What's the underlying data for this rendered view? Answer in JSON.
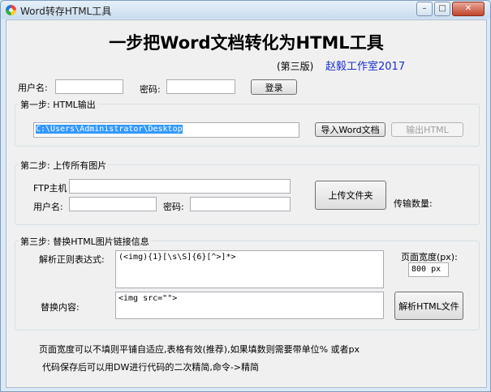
{
  "window": {
    "title": "Word转存HTML工具",
    "minimize_glyph": "–",
    "maximize_glyph": "□",
    "close_glyph": "✕"
  },
  "header": {
    "heading": "一步把Word文档转化为HTML工具",
    "edition": "(第三版)",
    "studio": "赵毅工作室2017",
    "studio_color": "#1a2fd0"
  },
  "login": {
    "username_label": "用户名:",
    "password_label": "密码:",
    "username_value": "",
    "password_value": "",
    "login_button": "登录"
  },
  "step1": {
    "title": "第一步: HTML输出",
    "path_value": "C:\\Users\\Administrator\\Desktop",
    "import_button": "导入Word文档",
    "export_button": "输出HTML",
    "selection_color": "#3399ff"
  },
  "step2": {
    "title": "第二步: 上传所有图片",
    "ftp_host_label": "FTP主机",
    "username_label": "用户名:",
    "password_label": "密码:",
    "ftp_host_value": "",
    "username_value": "",
    "password_value": "",
    "upload_button": "上传文件夹",
    "transfer_count_label": "传输数量:"
  },
  "step3": {
    "title": "第三步: 替换HTML图片链接信息",
    "regex_label": "解析正则表达式:",
    "regex_value": "(<img){1}[\\s\\S]{6}[^>]*>",
    "page_width_label": "页面宽度(px):",
    "page_width_value": "800 px",
    "replace_label": "替换内容:",
    "replace_value": "<img src=\"\">",
    "parse_button": "解析HTML文件"
  },
  "notes": {
    "line1": "页面宽度可以不填则平铺自适应,表格有效(推荐),如果填数则需要带单位% 或者px",
    "line2": "代码保存后可以用DW进行代码的二次精简,命令->精简"
  }
}
